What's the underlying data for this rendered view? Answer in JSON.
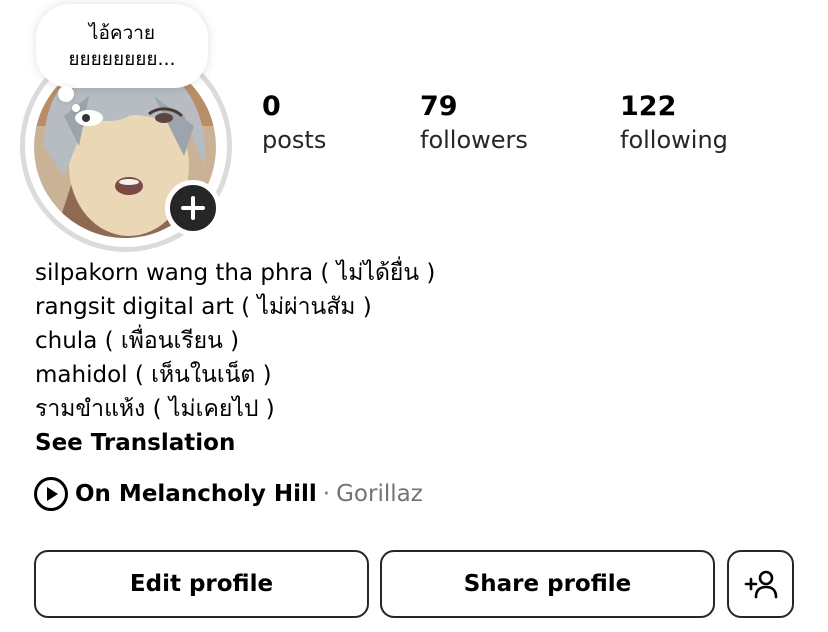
{
  "note": {
    "line1": "ไอ้ควาย",
    "line2": "ยยยยยยยย..."
  },
  "stats": [
    {
      "value": "0",
      "label": "posts"
    },
    {
      "value": "79",
      "label": "followers"
    },
    {
      "value": "122",
      "label": "following"
    }
  ],
  "bio": {
    "lines": [
      "silpakorn wang tha phra ( ไม่ได้ยื่น )",
      "rangsit digital art ( ไม่ผ่านสัม )",
      "chula ( เพื่อนเรียน )",
      "mahidol ( เห็นในเน็ต )",
      "รามขำแห้ง ( ไม่เคยไป )"
    ],
    "see_translation": "See Translation"
  },
  "music": {
    "song": "On Melancholy Hill",
    "separator": "·",
    "artist": "Gorillaz"
  },
  "buttons": {
    "edit_profile": "Edit profile",
    "share_profile": "Share profile"
  },
  "icons": {
    "add": "plus-icon",
    "play": "play-circle-icon",
    "add_person": "add-person-icon"
  },
  "colors": {
    "text": "#000000",
    "secondary": "#737373",
    "border": "#262626",
    "badge": "#262626"
  }
}
